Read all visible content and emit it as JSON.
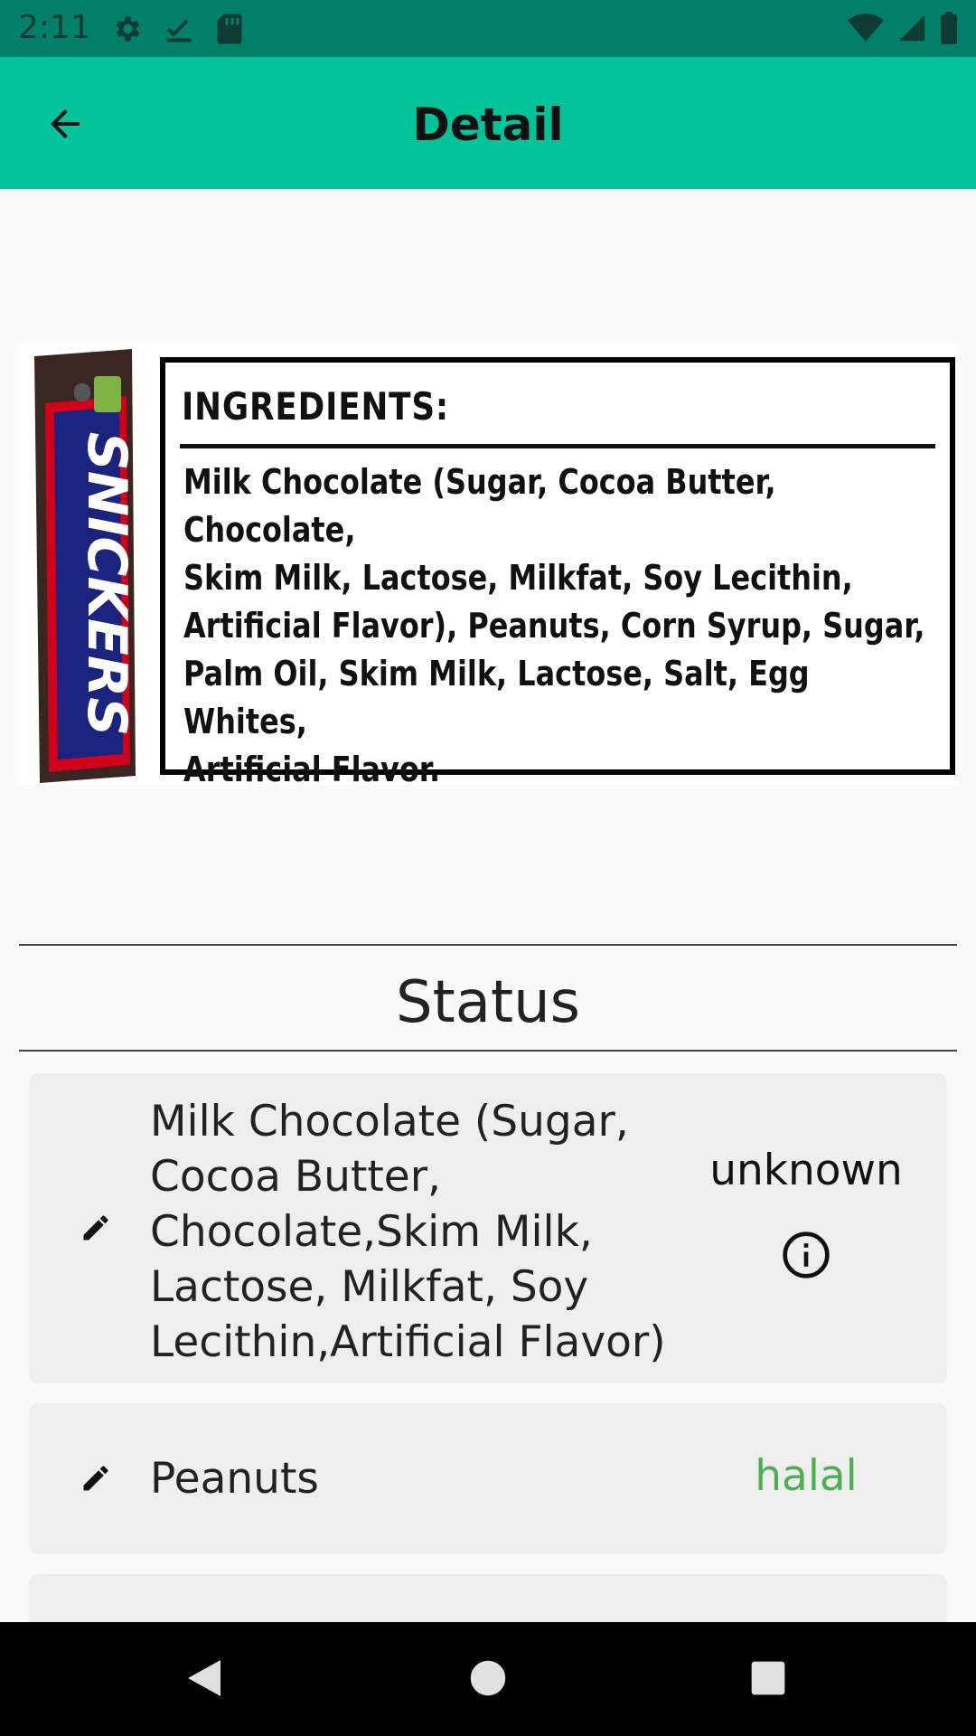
{
  "statusbar": {
    "time": "2:11"
  },
  "appbar": {
    "title": "Detail"
  },
  "product": {
    "brand": "SNICKERS",
    "ingredients_heading": "INGREDIENTS:",
    "ingredients_lines": [
      "Milk Chocolate (Sugar, Cocoa Butter, Chocolate,",
      "Skim Milk, Lactose, Milkfat, Soy Lecithin,",
      "Artificial Flavor), Peanuts, Corn Syrup, Sugar,",
      "Palm Oil, Skim Milk, Lactose, Salt, Egg Whites,",
      "Artificial Flavor."
    ]
  },
  "section": {
    "title": "Status"
  },
  "ingredients": [
    {
      "lines": [
        "Milk Chocolate (Sugar,",
        "Cocoa Butter,",
        "Chocolate,Skim Milk,",
        "Lactose, Milkfat, Soy",
        "Lecithin,Artificial Flavor)"
      ],
      "status": "unknown"
    },
    {
      "lines": [
        "Peanuts"
      ],
      "status": "halal"
    }
  ],
  "colors": {
    "appbar": "#02c39a",
    "statusbar": "#00806a",
    "halal": "#4caf50",
    "card": "#eeeeee"
  }
}
